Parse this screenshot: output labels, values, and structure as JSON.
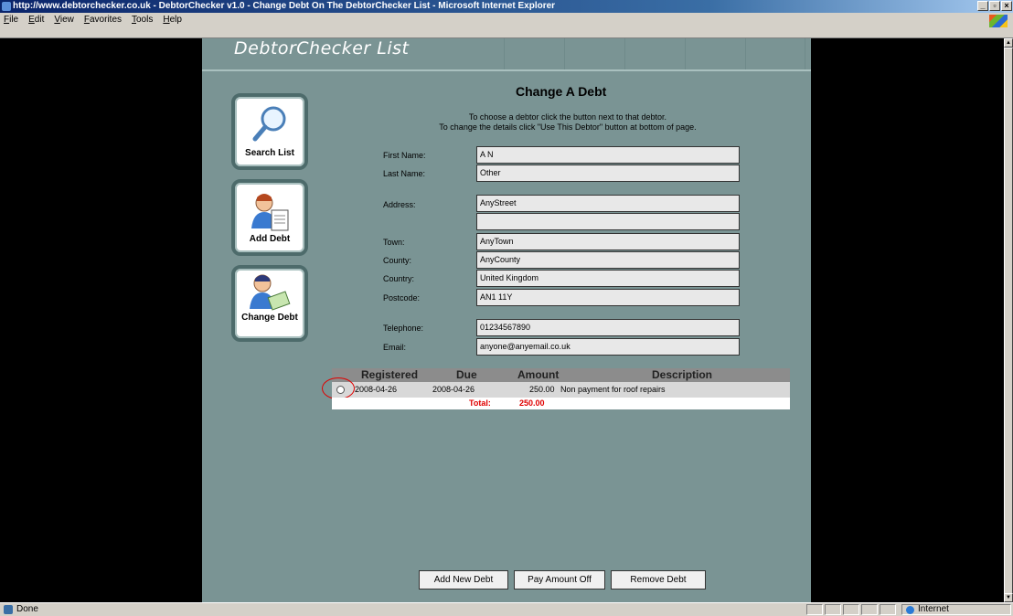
{
  "window": {
    "title": "http://www.debtorchecker.co.uk - DebtorChecker v1.0 - Change Debt On The DebtorChecker List - Microsoft Internet Explorer",
    "min": "_",
    "max": "▫",
    "close": "×"
  },
  "menu": [
    "File",
    "Edit",
    "View",
    "Favorites",
    "Tools",
    "Help"
  ],
  "site": {
    "logo": "DebtorChecker List"
  },
  "sidebar": [
    {
      "label": "Search List",
      "icon": "magnifier-icon"
    },
    {
      "label": "Add Debt",
      "icon": "person-document-icon"
    },
    {
      "label": "Change Debt",
      "icon": "person-money-icon"
    }
  ],
  "page": {
    "heading": "Change A Debt",
    "instructions": [
      "To choose a debtor click the button next to that debtor.",
      "To change the details click \"Use This Debtor\" button at bottom of page."
    ]
  },
  "form": {
    "first_name": {
      "label": "First Name:",
      "value": "A N"
    },
    "last_name": {
      "label": "Last Name:",
      "value": "Other"
    },
    "address": {
      "label": "Address:",
      "value": "AnyStreet",
      "value2": ""
    },
    "town": {
      "label": "Town:",
      "value": "AnyTown"
    },
    "county": {
      "label": "County:",
      "value": "AnyCounty"
    },
    "country": {
      "label": "Country:",
      "value": "United Kingdom"
    },
    "postcode": {
      "label": "Postcode:",
      "value": "AN1 11Y"
    },
    "telephone": {
      "label": "Telephone:",
      "value": "01234567890"
    },
    "email": {
      "label": "Email:",
      "value": "anyone@anyemail.co.uk"
    }
  },
  "debts": {
    "headers": [
      "Registered",
      "Due",
      "Amount",
      "Description"
    ],
    "rows": [
      {
        "registered": "2008-04-26",
        "due": "2008-04-26",
        "amount": "250.00",
        "description": "Non payment for roof repairs"
      }
    ],
    "total_label": "Total:",
    "total_value": "250.00"
  },
  "buttons": {
    "add_new_debt": "Add New Debt",
    "pay_amount_off": "Pay Amount Off",
    "remove_debt": "Remove Debt"
  },
  "status": {
    "text": "Done",
    "zone": "Internet"
  },
  "colors": {
    "page_bg": "#7a9494",
    "total_red": "#e00000",
    "title_bar": "#0a246a"
  }
}
